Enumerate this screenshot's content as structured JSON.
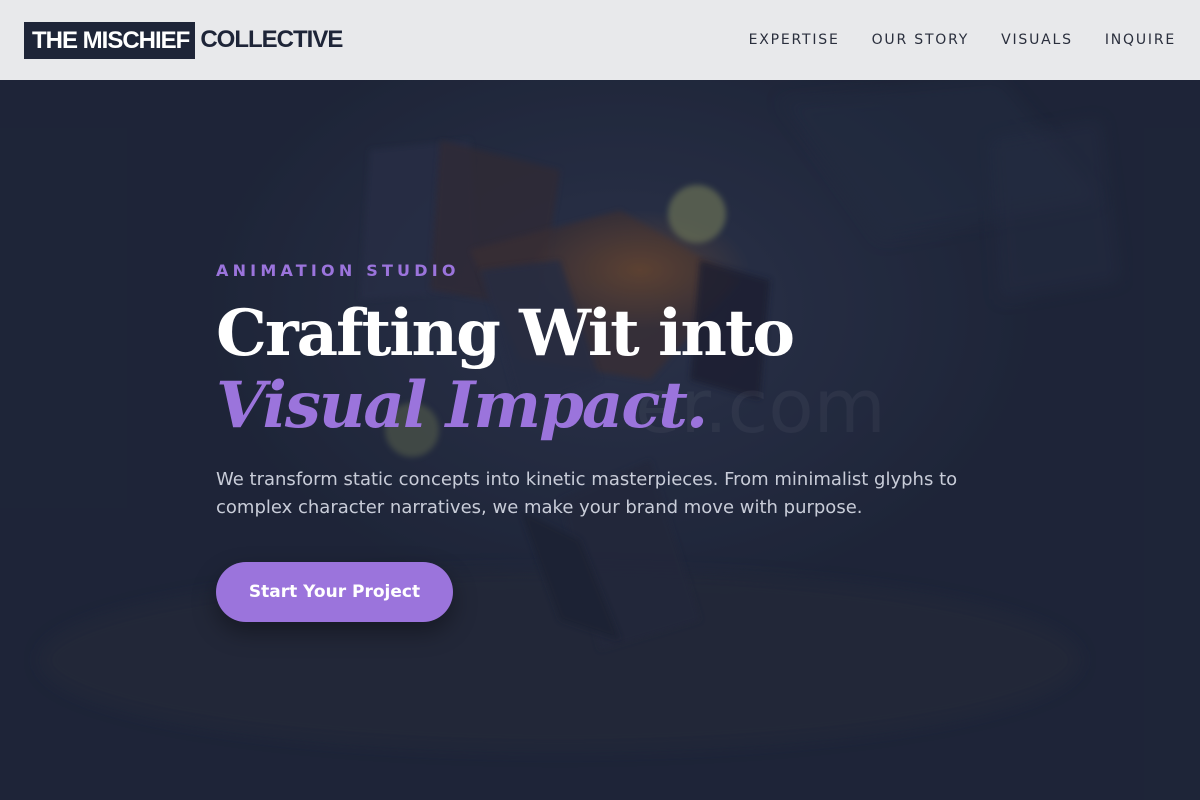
{
  "header": {
    "logo_box": "THE MISCHIEF",
    "logo_rest": "COLLECTIVE",
    "nav": [
      "EXPERTISE",
      "OUR STORY",
      "VISUALS",
      "INQUIRE"
    ]
  },
  "hero": {
    "eyebrow": "ANIMATION STUDIO",
    "headline_line1": "Crafting Wit into",
    "headline_line2": "Visual Impact.",
    "lead": "We transform static concepts into kinetic masterpieces. From minimalist glyphs to complex character narratives, we make your brand move with purpose.",
    "cta_label": "Start Your Project",
    "watermark": "er.com"
  },
  "colors": {
    "dark_navy": "#1e2538",
    "accent_purple": "#9b74dc",
    "header_bg": "#e8e9eb",
    "text_muted": "#c8ccd8"
  }
}
